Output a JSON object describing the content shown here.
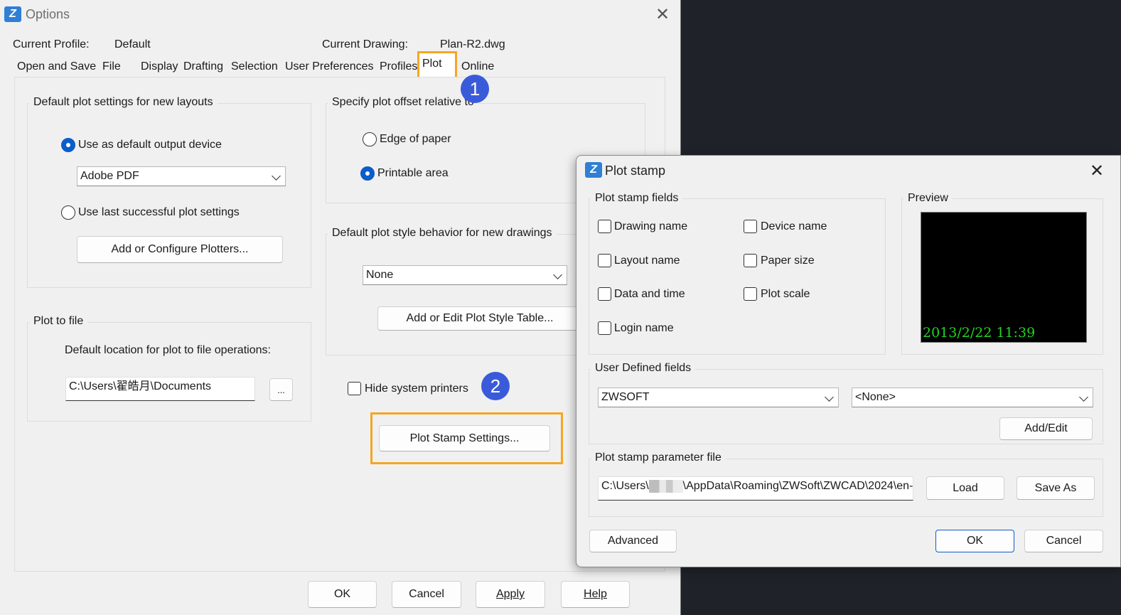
{
  "options": {
    "title": "Options",
    "current_profile_label": "Current Profile:",
    "current_profile_value": "Default",
    "current_drawing_label": "Current Drawing:",
    "current_drawing_value": "Plan-R2.dwg",
    "tabs": [
      {
        "label": "Open and Save"
      },
      {
        "label": "File"
      },
      {
        "label": "Display"
      },
      {
        "label": "Drafting"
      },
      {
        "label": "Selection"
      },
      {
        "label": "User Preferences"
      },
      {
        "label": "Profiles"
      },
      {
        "label": "Plot",
        "active": true
      },
      {
        "label": "Online"
      }
    ],
    "default_plot": {
      "title": "Default plot settings for new layouts",
      "use_default_device": "Use as default output device",
      "device": "Adobe PDF",
      "use_last": "Use last successful plot settings",
      "add_plotters_btn": "Add or Configure Plotters..."
    },
    "offset": {
      "title": "Specify plot offset relative to",
      "edge": "Edge of paper",
      "printable": "Printable area"
    },
    "style_behavior": {
      "title": "Default plot style behavior for new drawings",
      "value": "None",
      "add_edit_btn": "Add or Edit Plot Style Table..."
    },
    "plot_to_file": {
      "title": "Plot to file",
      "desc": "Default location for plot to file operations:",
      "path": "C:\\Users\\翟皓月\\Documents",
      "browse": "..."
    },
    "hide_printers": "Hide system printers",
    "stamp_btn": "Plot Stamp Settings...",
    "ok": "OK",
    "cancel": "Cancel",
    "apply": "Apply",
    "help": "Help"
  },
  "badges": {
    "one": "1",
    "two": "2"
  },
  "stamp": {
    "title": "Plot stamp",
    "fields_title": "Plot stamp fields",
    "fields": {
      "drawing_name": "Drawing name",
      "device_name": "Device name",
      "layout_name": "Layout name",
      "paper_size": "Paper size",
      "data_time": "Data and time",
      "plot_scale": "Plot scale",
      "login_name": "Login name"
    },
    "preview_title": "Preview",
    "preview_text": "2013/2/22 11:39",
    "user_fields_title": "User Defined fields",
    "user_field_1": "ZWSOFT",
    "user_field_2": "<None>",
    "add_edit": "Add/Edit",
    "param_title": "Plot stamp parameter file",
    "param_path_prefix": "C:\\Users\\",
    "param_path_suffix": "\\AppData\\Roaming\\ZWSoft\\ZWCAD\\2024\\en-",
    "load": "Load",
    "save_as": "Save As",
    "advanced": "Advanced",
    "ok": "OK",
    "cancel": "Cancel"
  }
}
